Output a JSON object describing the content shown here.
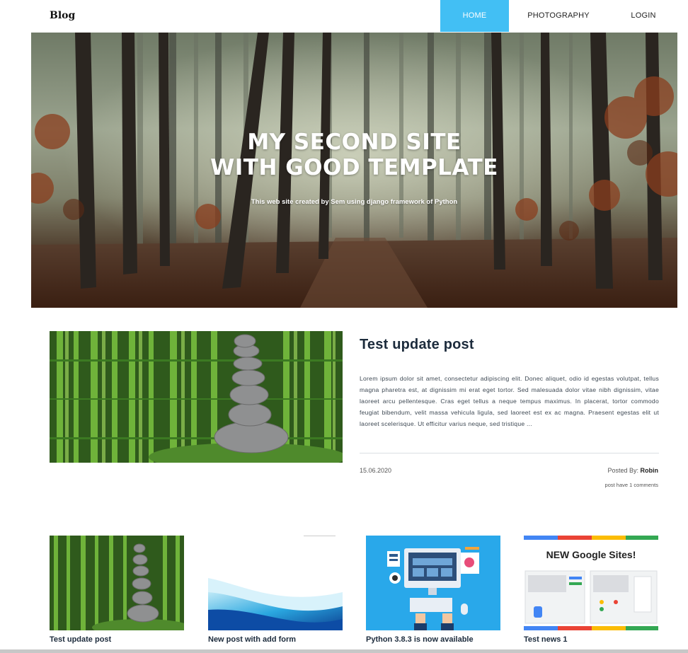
{
  "nav": {
    "brand": "Blog",
    "items": [
      {
        "label": "HOME",
        "active": true
      },
      {
        "label": "PHOTOGRAPHY",
        "active": false
      },
      {
        "label": "LOGIN",
        "active": false
      }
    ],
    "active_color": "#42bff4"
  },
  "hero": {
    "title_line1": "MY SECOND SITE",
    "title_line2": "WITH GOOD TEMPLATE",
    "subtitle": "This web site created by Sem using django framework of Python"
  },
  "featured": {
    "title": "Test update post",
    "body": "Lorem ipsum dolor sit amet, consectetur adipiscing elit. Donec aliquet, odio id egestas volutpat, tellus magna pharetra est, at dignissim mi erat eget tortor. Sed malesuada dolor vitae nibh dignissim, vitae laoreet arcu pellentesque. Cras eget tellus a neque tempus maximus. In placerat, tortor commodo feugiat bibendum, velit massa vehicula ligula, sed laoreet est ex ac magna. Praesent egestas elit ut laoreet scelerisque. Ut efficitur varius neque, sed tristique ...",
    "date": "15.06.2020",
    "posted_by_label": "Posted By:",
    "author": "Robin",
    "comments": "post have 1 comments"
  },
  "cards": [
    {
      "title": "Test update post"
    },
    {
      "title": "New post with add form"
    },
    {
      "title": "Python 3.8.3 is now available"
    },
    {
      "title": "Test news 1",
      "image_heading": "NEW Google Sites!"
    }
  ]
}
